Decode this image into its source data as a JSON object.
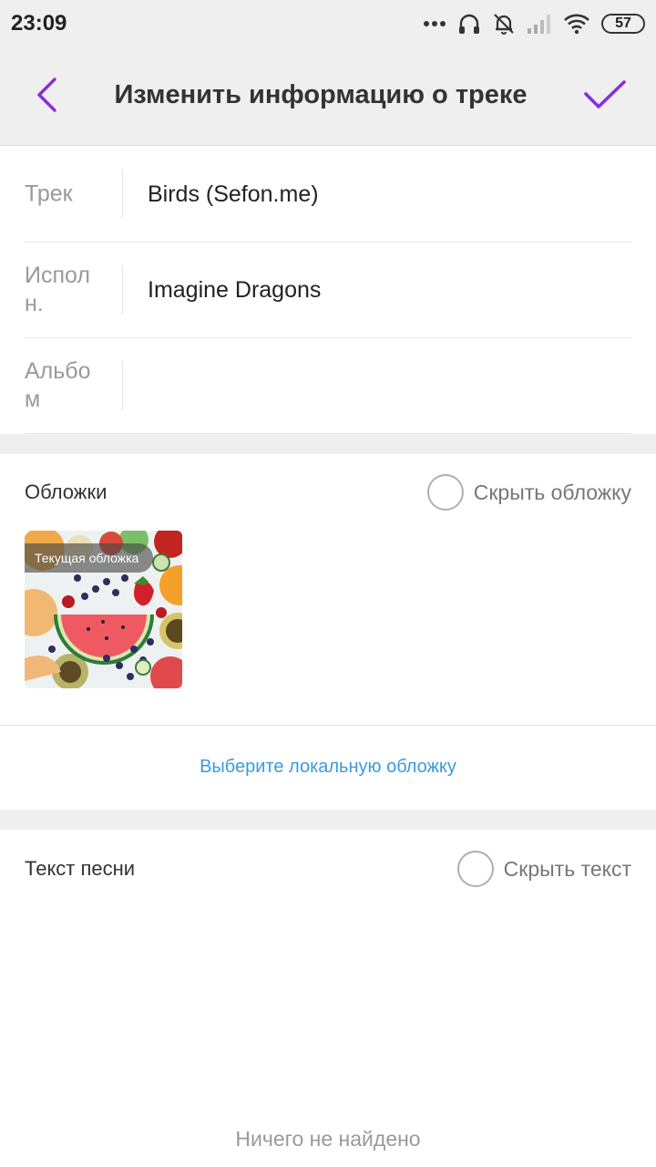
{
  "status_bar": {
    "time": "23:09",
    "battery": "57",
    "icons": [
      "more-dots-icon",
      "headphones-icon",
      "bell-off-icon",
      "signal-icon",
      "wifi-icon",
      "battery-icon"
    ]
  },
  "header": {
    "title": "Изменить информацию о треке",
    "accent_color": "#8a2be2"
  },
  "form": {
    "track_label": "Трек",
    "track_value": "Birds (Sefon.me)",
    "artist_label": "Испол\nн.",
    "artist_value": "Imagine Dragons",
    "album_label": "Альбо\nм",
    "album_value": ""
  },
  "covers": {
    "title": "Обложки",
    "hide_label": "Скрыть обложку",
    "current_badge": "Текущая обложка",
    "choose_local": "Выберите локальную обложку",
    "link_color": "#3b9ae0"
  },
  "lyrics": {
    "title": "Текст песни",
    "hide_label": "Скрыть текст",
    "empty_message": "Ничего не найдено"
  }
}
